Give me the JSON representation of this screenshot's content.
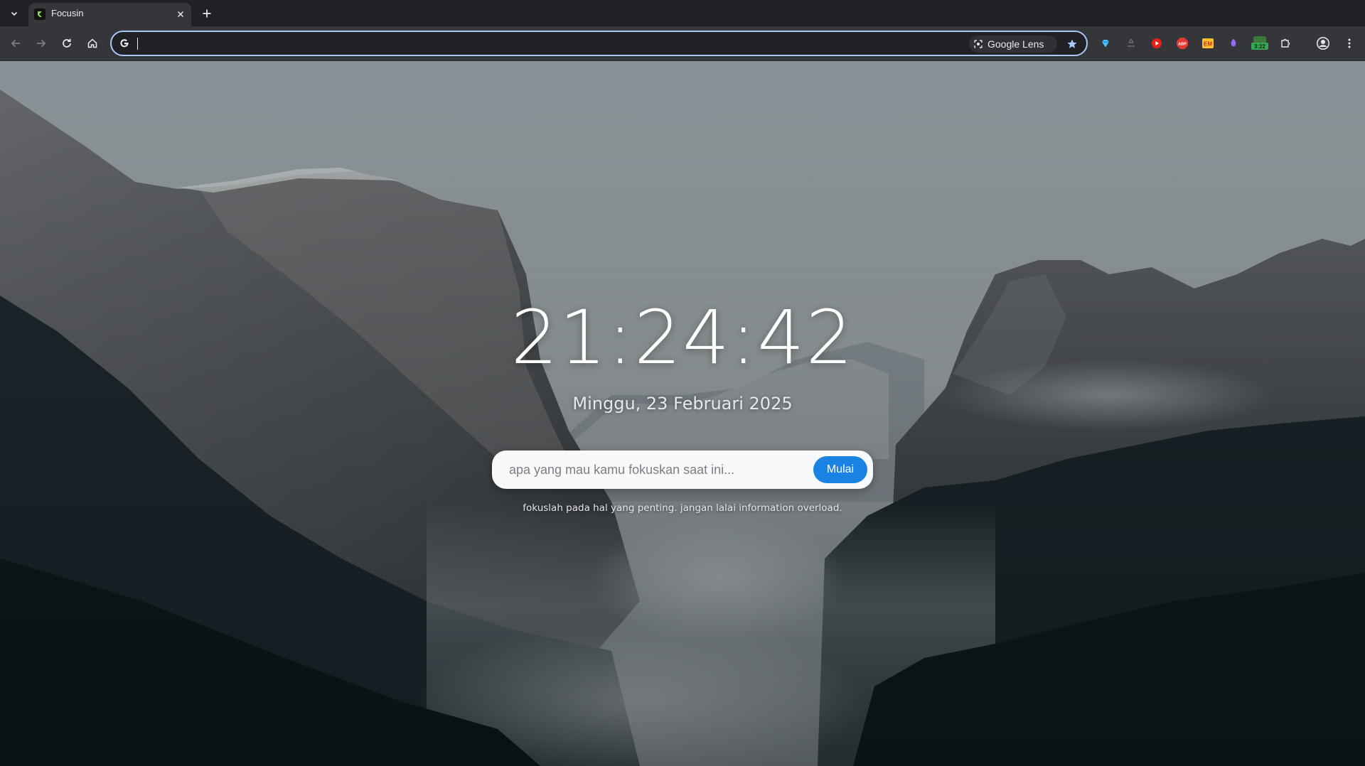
{
  "browser": {
    "tab": {
      "title": "Focusin",
      "favicon": "focusin-logo-icon"
    },
    "omnibox": {
      "value": "",
      "lens_label": "Google Lens"
    },
    "toolbar_icons": [
      "back-icon",
      "forward-icon",
      "reload-icon",
      "home-icon",
      "bookmark-star-icon"
    ],
    "extensions": [
      {
        "name": "gem-extension-icon",
        "color": "#4fc3f7"
      },
      {
        "name": "recycle-extension-icon",
        "color": "#5f6368"
      },
      {
        "name": "youtube-extension-icon",
        "color": "#ff0000"
      },
      {
        "name": "adblock-plus-icon",
        "label": "ABP",
        "color": "#e53935"
      },
      {
        "name": "em-extension-icon",
        "label": "EM",
        "color": "#fbc02d"
      },
      {
        "name": "purple-extension-icon",
        "color": "#8e6cef"
      },
      {
        "name": "timer-extension-icon",
        "label": "3:22",
        "color": "#34a853"
      },
      {
        "name": "puzzle-extensions-icon",
        "color": "#e8eaed"
      }
    ],
    "profile": "profile-avatar-icon",
    "menu": "kebab-menu-icon"
  },
  "page": {
    "clock": "21:24:42",
    "date": "Minggu, 23 Februari 2025",
    "focus_input": {
      "placeholder": "apa yang mau kamu fokuskan saat ini...",
      "value": ""
    },
    "start_button": "Mulai",
    "tagline": "fokuslah pada hal yang penting. jangan lalai information overload.",
    "background": "yosemite-valley-wallpaper",
    "colors": {
      "accent": "#1a82e2",
      "sky": "#9aa3a8",
      "forest": "#1c2a30"
    }
  }
}
